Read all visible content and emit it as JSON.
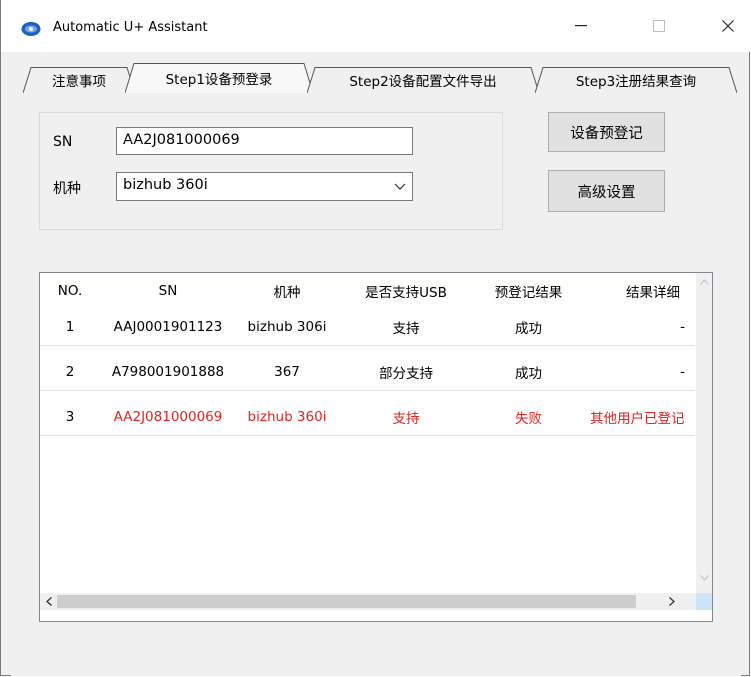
{
  "window": {
    "title": "Automatic U+ Assistant",
    "minimize_glyph": "—",
    "maximize_glyph": "☐",
    "close_glyph": "✕"
  },
  "tabs": [
    {
      "label": "注意事项"
    },
    {
      "label": "Step1设备预登录"
    },
    {
      "label": "Step2设备配置文件导出"
    },
    {
      "label": "Step3注册结果查询"
    }
  ],
  "form": {
    "sn_label": "SN",
    "sn_value": "AA2J081000069",
    "model_label": "机种",
    "model_value": "bizhub 360i",
    "prereg_button": "设备预登记",
    "advanced_button": "高级设置"
  },
  "table": {
    "headers": [
      "NO.",
      "SN",
      "机种",
      "是否支持USB",
      "预登记结果",
      "结果详细"
    ],
    "rows": [
      {
        "no": "1",
        "sn": "AAJ0001901123",
        "model": "bizhub 306i",
        "usb": "支持",
        "result": "成功",
        "detail": "-",
        "error": false
      },
      {
        "no": "2",
        "sn": "A798001901888",
        "model": "367",
        "usb": "部分支持",
        "result": "成功",
        "detail": "-",
        "error": false
      },
      {
        "no": "3",
        "sn": "AA2J081000069",
        "model": "bizhub 360i",
        "usb": "支持",
        "result": "失败",
        "detail": "其他用户已登记",
        "error": true
      }
    ]
  },
  "colors": {
    "error_text": "#e8231f",
    "window_bg": "#f0f0f0"
  }
}
